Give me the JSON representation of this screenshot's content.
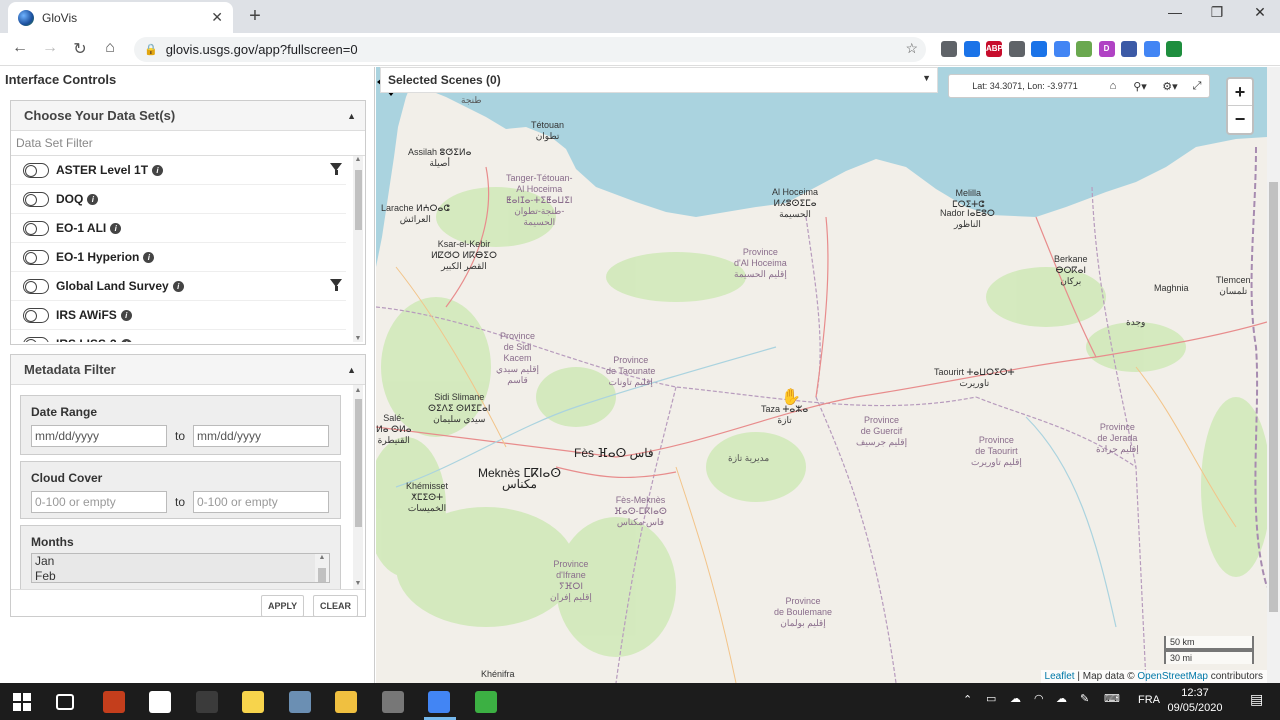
{
  "browser": {
    "tab_title": "GloVis",
    "tab_close": "✕",
    "new_tab": "+",
    "url": "glovis.usgs.gov/app?fullscreen=0",
    "window_controls": [
      "—",
      "❐",
      "✕"
    ],
    "extensions": [
      {
        "label": "",
        "color": "#5f6368"
      },
      {
        "label": "",
        "color": "#1a73e8"
      },
      {
        "label": "ABP",
        "color": "#c70d2c"
      },
      {
        "label": "",
        "color": "#5f6368"
      },
      {
        "label": "",
        "color": "#1a73e8"
      },
      {
        "label": "",
        "color": "#4285f4"
      },
      {
        "label": "",
        "color": "#6aa84f"
      },
      {
        "label": "D",
        "color": "#b042c4"
      },
      {
        "label": "",
        "color": "#3c5aa6"
      },
      {
        "label": "",
        "color": "#4285f4"
      },
      {
        "label": "",
        "color": "#1e8e3e"
      }
    ]
  },
  "left_panel": {
    "title": "Interface Controls",
    "datasets_box": {
      "header": "Choose Your Data Set(s)",
      "filter_placeholder": "Data Set Filter",
      "items": [
        {
          "name": "ASTER Level 1T",
          "has_filter": true
        },
        {
          "name": "DOQ",
          "has_filter": false
        },
        {
          "name": "EO-1 ALI",
          "has_filter": false
        },
        {
          "name": "EO-1 Hyperion",
          "has_filter": false
        },
        {
          "name": "Global Land Survey",
          "has_filter": true
        },
        {
          "name": "IRS AWiFS",
          "has_filter": false
        },
        {
          "name": "IRS LISS-3",
          "has_filter": false
        }
      ]
    },
    "metadata_box": {
      "header": "Metadata Filter",
      "date_range": {
        "label": "Date Range",
        "from_value": "mm/dd/yyyy",
        "to_label": "to",
        "to_value": "mm/dd/yyyy"
      },
      "cloud_cover": {
        "label": "Cloud Cover",
        "from_placeholder": "0-100 or empty",
        "to_label": "to",
        "to_placeholder": "0-100 or empty"
      },
      "months": {
        "label": "Months",
        "options": [
          "Jan",
          "Feb"
        ]
      },
      "apply_label": "APPLY",
      "clear_label": "CLEAR"
    }
  },
  "map": {
    "selected_scenes": "Selected Scenes (0)",
    "coords": "Lat: 34.3071, Lon: -3.9771",
    "zoom_in": "+",
    "zoom_out": "−",
    "scale_km": "50 km",
    "scale_mi": "30 mi",
    "attribution": {
      "leaflet": "Leaflet",
      "sep": " | Map data © ",
      "osm": "OpenStreetMap",
      "tail": " contributors"
    },
    "labels": {
      "tetouan": "Tétouan\nتطوان",
      "tetouan_arabic_top": "طنجة",
      "assilah": "Assilah ⵓⵚⵉⵍⴰ\nأصيلة",
      "tanger_tetouan": "Tanger-Tétouan-\nAl Hoceima\nⵟⴰⵏⵊⴰ-ⵜⵉⵟⴰⵡⵉⵏ\nطنجة-تطوان-\nالحسيمة",
      "larache": "Larache ⵍⵄⵔⴰⵛ\nالعرائش",
      "ksar": "Ksar-el-Kebir\nⵍⵇⵚⵔ ⵍⴽⴱⵉⵔ\nالقصر الكبير",
      "al_hoceima": "Al Hoceima\nⵍⵃⵓⵙⵉⵎⴰ\nالحسيمة",
      "melilla": "Melilla\nⵎⵔⵉⵜⵛ",
      "nador": "Nador ⵏⴰⴹⵓⵔ\nالناظور",
      "berkane": "Berkane\nⴱⵔⴽⴰⵏ\nبركان",
      "maghnia": "Maghnia",
      "tlemcen": "Tlemcen\nتلمسان",
      "oujda": "وجدة",
      "prov_hoceima": "Province\nd'Al Hoceima\nإقليم الحسيمة",
      "prov_sidi_kacem": "Province\nde Sidi\nKacem\nإقليم سيدي\nقاسم",
      "prov_taounate": "Province\nde Taounate\nإقليم تاونات",
      "sidi_slimane": "Sidi Slimane\nⵙⵉⴷⵉ ⵙⵍⵉⵎⴰⵏ\nسيدي سليمان",
      "taza": "Taza ⵜⴰⵣⴰ\nتازة",
      "taourirt": "Taourirt ⵜⴰⵡⵔⵉⵔⵜ\nتاوريرت",
      "prov_guercif": "Province\nde Guercif\nإقليم جرسيف",
      "prov_taourirt": "Province\nde Taourirt\nإقليم تاوريرت",
      "prov_jerada": "Province\nde Jerada\nإقليم جرادة",
      "fes": "Fès ⴼⴰⵙ فاس",
      "meknes": "Meknès ⵎⴽⵏⴰⵙ\nمكناس",
      "khemisset": "Khémisset\nⵅⵎⵉⵙⵜ\nالخميسات",
      "fes_meknes": "Fès-Meknès\nⴼⴰⵙ-ⵎⴽⵏⴰⵙ\nفاس-مكناس",
      "prov_ifrane": "Province\nd'Ifrane\nⵢⴼⵔⵏ\nإقليم إفران",
      "prov_boulemane": "Province\nde Boulemane\nإقليم بولمان",
      "salé": "Salé-\nⵍⴰ ⵙⵍⴰ\nالقنيطرة",
      "khenifra": "Khénifra",
      "meknes_area": "مديرية تازة"
    }
  },
  "taskbar": {
    "lang": "FRA",
    "time": "12:37",
    "date": "09/05/2020",
    "apps": [
      {
        "name": "task-view",
        "color": "#1c1c1c"
      },
      {
        "name": "powerpoint",
        "color": "#c43e1c"
      },
      {
        "name": "file",
        "color": "#ffffff"
      },
      {
        "name": "calculator",
        "color": "#3b3b3b"
      },
      {
        "name": "sticky-notes",
        "color": "#f7d44c"
      },
      {
        "name": "settings",
        "color": "#6b8fb3"
      },
      {
        "name": "explorer",
        "color": "#f0c040"
      },
      {
        "name": "globe-app",
        "color": "#777777"
      },
      {
        "name": "chrome",
        "color": "#4285f4"
      },
      {
        "name": "camtasia",
        "color": "#3cb043"
      }
    ]
  }
}
